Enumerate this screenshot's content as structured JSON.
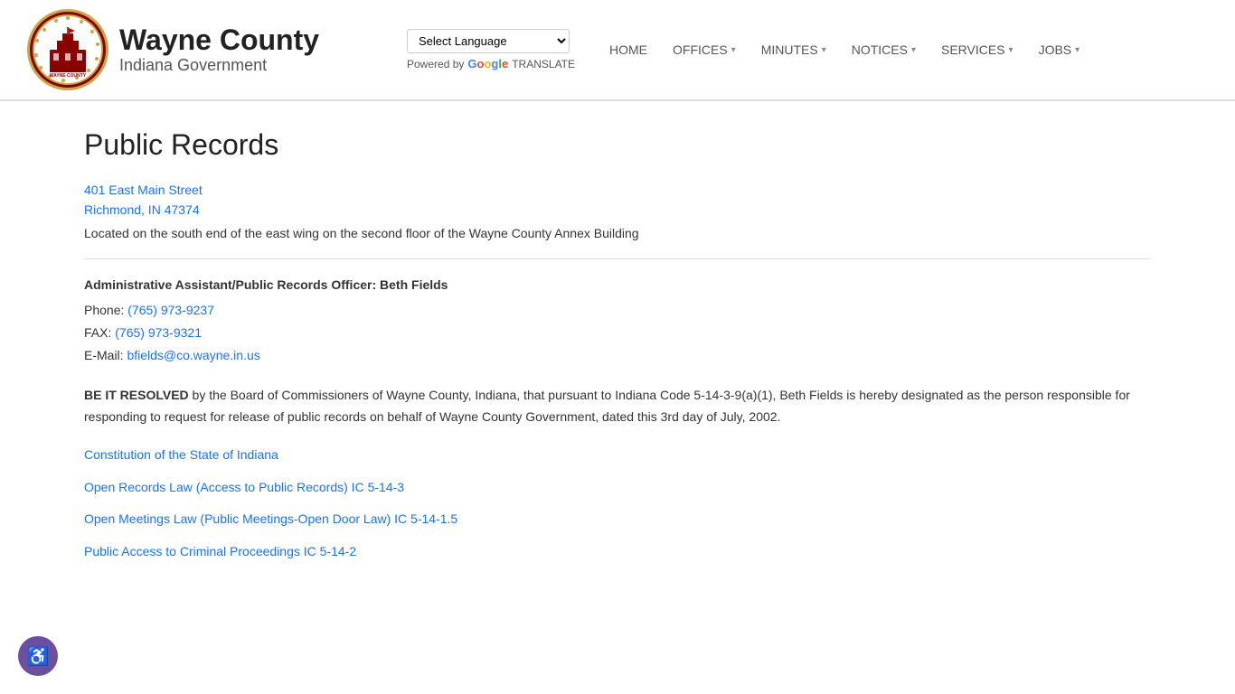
{
  "header": {
    "logo_alt": "Wayne County Seal",
    "title": "Wayne County",
    "subtitle": "Indiana Government",
    "translate_label": "Select Language",
    "powered_by": "Powered by",
    "google_label": "Google",
    "translate_word": "TRANSLATE"
  },
  "nav": {
    "items": [
      {
        "label": "HOME",
        "has_dropdown": false
      },
      {
        "label": "OFFICES",
        "has_dropdown": true
      },
      {
        "label": "MINUTES",
        "has_dropdown": true
      },
      {
        "label": "NOTICES",
        "has_dropdown": true
      },
      {
        "label": "SERVICES",
        "has_dropdown": true
      },
      {
        "label": "JOBS",
        "has_dropdown": true
      }
    ]
  },
  "main": {
    "page_title": "Public Records",
    "address_line1": "401 East Main Street",
    "address_line2": "Richmond, IN 47374",
    "location_text": "Located on the south end of the east wing on the second floor of the Wayne County Annex Building",
    "officer_title": "Administrative Assistant/Public Records Officer: Beth Fields",
    "phone_label": "Phone:",
    "phone_number": "(765) 973-9237",
    "fax_label": "FAX:",
    "fax_number": "(765) 973-9321",
    "email_label": "E-Mail:",
    "email_address": "bfields@co.wayne.in.us",
    "resolution_text": "BE IT RESOLVED by the Board of Commissioners of Wayne County, Indiana, that pursuant to Indiana Code 5-14-3-9(a)(1), Beth Fields is hereby designated as the person responsible for responding to request for release of public records on behalf of Wayne County Government, dated this 3rd day of July, 2002.",
    "links": [
      {
        "label": "Constitution of the State of Indiana",
        "href": "#"
      },
      {
        "label": "Open Records Law (Access to Public Records) IC 5-14-3",
        "href": "#"
      },
      {
        "label": "Open Meetings Law (Public Meetings-Open Door Law) IC 5-14-1.5",
        "href": "#"
      },
      {
        "label": "Public Access to Criminal Proceedings IC 5-14-2",
        "href": "#"
      }
    ]
  },
  "accessibility": {
    "label": "Accessibility Options",
    "icon": "♿"
  }
}
